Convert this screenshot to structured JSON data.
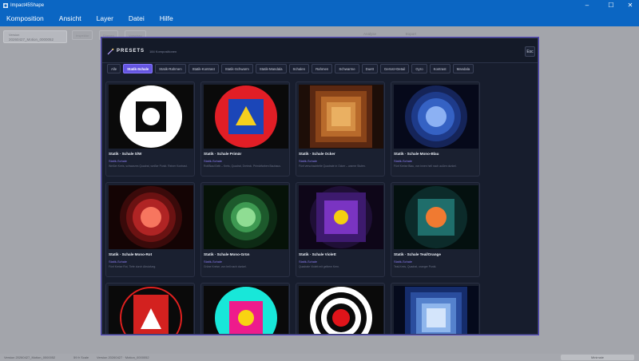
{
  "window": {
    "title": "Impact45Shape"
  },
  "menu": [
    "Komposition",
    "Ansicht",
    "Layer",
    "Datei",
    "Hilfe"
  ],
  "background": {
    "chip_line1": "Version",
    "chip_line2": "20260427_Motion_0000052",
    "buttons": [
      "Inspektor",
      "Ebenen",
      "Vorschau"
    ],
    "right_items": [
      "Analyse",
      "Export"
    ]
  },
  "statusbar": {
    "left": "Version 20260427_Motion_0000052",
    "mid1": "59 fr Scale",
    "mid2": "Version 20260427 · Motion_0000052",
    "button": "Minimale"
  },
  "modal": {
    "title": "PRESETS",
    "subtitle": "184 Kompositionen",
    "close": "Esc",
    "tabs": [
      "Alle",
      "Statik-Schale",
      "Statik-Rahmen",
      "Statik-Kontrast",
      "Statik-Schwarm",
      "Statik-Mandala",
      "Schalen",
      "Rahmen",
      "Schwarme",
      "Duett",
      "Gerüst+Detail",
      "Gyro",
      "Kontrast",
      "Mandala"
    ],
    "active_tab": "Statik-Schale",
    "cards": [
      {
        "title": "Statik · Schale S/W",
        "category": "Statik-Schale",
        "desc": "Weißer Kreis, schwarzes Quadrat, weißer Punkt. Reiner Kontrast."
      },
      {
        "title": "Statik · Schale Primär",
        "category": "Statik-Schale",
        "desc": "Rot/Blau/Gelb – Kreis, Quadrat, Dreieck. Primärfarben Bauhaus."
      },
      {
        "title": "Statik · Schale Ocker",
        "category": "Statik-Schale",
        "desc": "Fünf verschachtelte Quadrate in Ocker – warme Stufen."
      },
      {
        "title": "Statik · Schale Mono-Blau",
        "category": "Statik-Schale",
        "desc": "Fünf Kreise Blau, von innen hell nach außen dunkel."
      },
      {
        "title": "Statik · Schale Mono-Rot",
        "category": "Statik-Schale",
        "desc": "Fünf Kreise Rot, Tiefe durch Abstufung."
      },
      {
        "title": "Statik · Schale Mono-Grün",
        "category": "Statik-Schale",
        "desc": "Grüne Kreise, von hell nach dunkel."
      },
      {
        "title": "Statik · Schale Violett",
        "category": "Statik-Schale",
        "desc": "Quadrate Violett mit gelbem Kern."
      },
      {
        "title": "Statik · Schale Teal/Orange",
        "category": "Statik-Schale",
        "desc": "Teal-Kreis, Quadrat, oranger Punkt."
      },
      {
        "title": "",
        "category": "",
        "desc": ""
      },
      {
        "title": "",
        "category": "",
        "desc": ""
      },
      {
        "title": "",
        "category": "",
        "desc": ""
      },
      {
        "title": "",
        "category": "",
        "desc": ""
      }
    ]
  }
}
